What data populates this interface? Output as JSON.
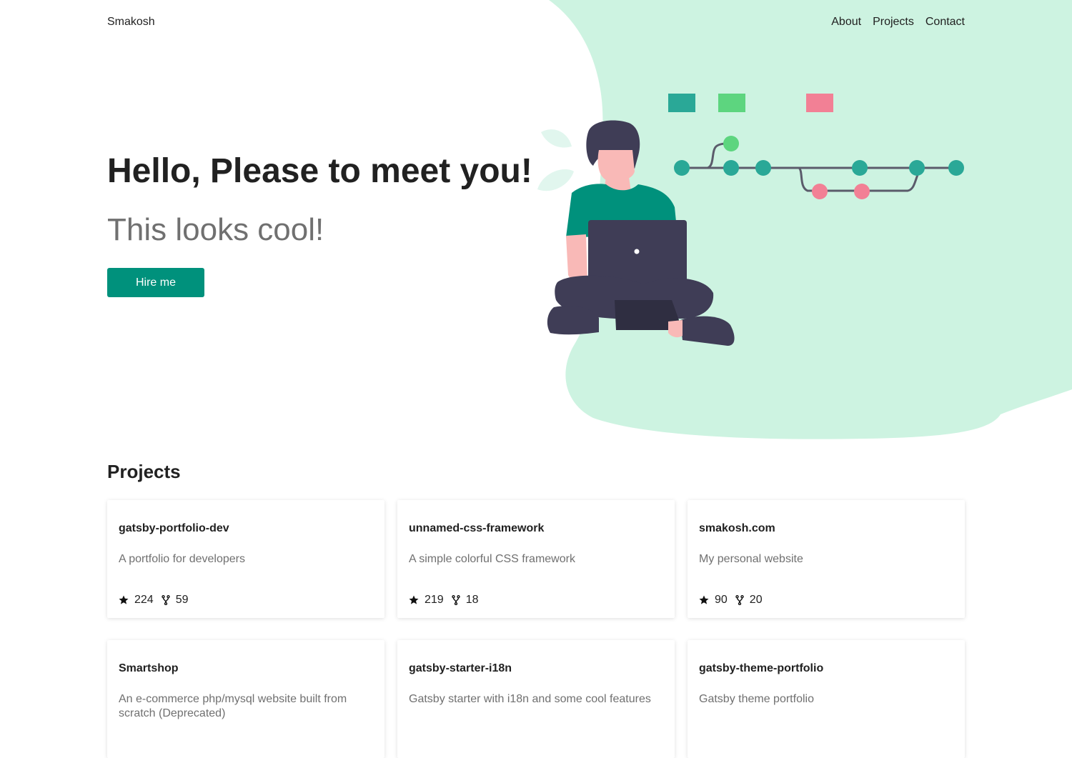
{
  "nav": {
    "brand": "Smakosh",
    "links": [
      "About",
      "Projects",
      "Contact"
    ]
  },
  "hero": {
    "title": "Hello, Please to meet you!",
    "subtitle": "This looks cool!",
    "cta": "Hire me"
  },
  "projects": {
    "heading": "Projects",
    "items": [
      {
        "name": "gatsby-portfolio-dev",
        "description": "A portfolio for developers",
        "stars": "224",
        "forks": "59"
      },
      {
        "name": "unnamed-css-framework",
        "description": "A simple colorful CSS framework",
        "stars": "219",
        "forks": "18"
      },
      {
        "name": "smakosh.com",
        "description": "My personal website",
        "stars": "90",
        "forks": "20"
      },
      {
        "name": "Smartshop",
        "description": "An e-commerce php/mysql website built from scratch (Deprecated)",
        "stars": "",
        "forks": ""
      },
      {
        "name": "gatsby-starter-i18n",
        "description": "Gatsby starter with i18n and some cool features",
        "stars": "",
        "forks": ""
      },
      {
        "name": "gatsby-theme-portfolio",
        "description": "Gatsby theme portfolio",
        "stars": "",
        "forks": ""
      }
    ]
  },
  "icons": {
    "star": "star-icon",
    "fork": "fork-icon"
  },
  "colors": {
    "accent": "#00917c",
    "blob": "#cdf3e1",
    "teal": "#2aa897",
    "green": "#5dd57f",
    "pink": "#f28095",
    "dark": "#3f3d56"
  }
}
